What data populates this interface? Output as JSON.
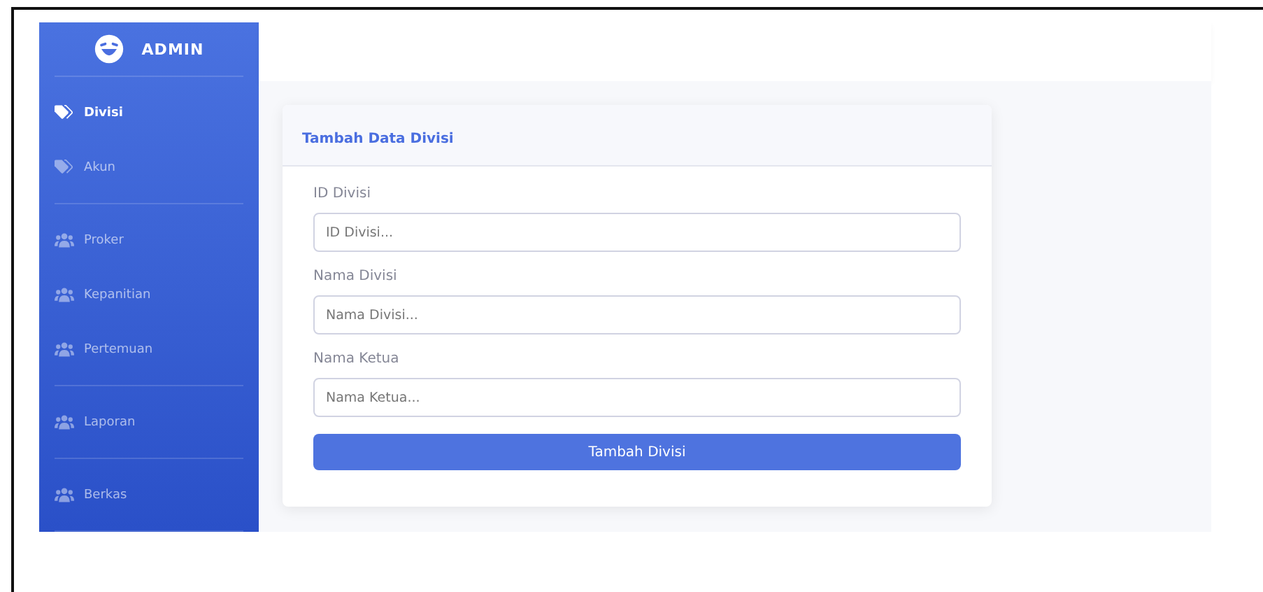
{
  "brand": {
    "title": "ADMIN"
  },
  "sidebar": {
    "sections": [
      {
        "items": [
          {
            "label": "Divisi",
            "kind": "tag",
            "selected": true
          },
          {
            "label": "Akun",
            "kind": "tag",
            "selected": false
          }
        ]
      },
      {
        "items": [
          {
            "label": "Proker",
            "kind": "group",
            "selected": false
          },
          {
            "label": "Kepanitian",
            "kind": "group",
            "selected": false
          },
          {
            "label": "Pertemuan",
            "kind": "group",
            "selected": false
          }
        ]
      },
      {
        "items": [
          {
            "label": "Laporan",
            "kind": "group",
            "selected": false
          }
        ]
      },
      {
        "items": [
          {
            "label": "Berkas",
            "kind": "group",
            "selected": false
          }
        ]
      }
    ]
  },
  "card": {
    "title": "Tambah Data Divisi",
    "fields": [
      {
        "label": "ID Divisi",
        "placeholder": "ID Divisi..."
      },
      {
        "label": "Nama Divisi",
        "placeholder": "Nama Divisi..."
      },
      {
        "label": "Nama Ketua",
        "placeholder": "Nama Ketua..."
      }
    ],
    "button": "Tambah Divisi"
  }
}
